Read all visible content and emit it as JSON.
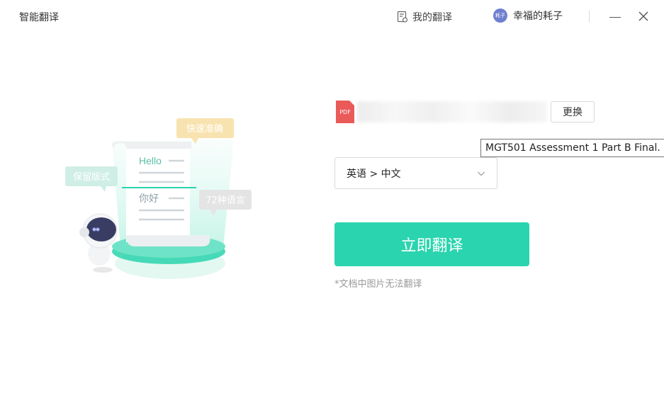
{
  "app": {
    "title": "智能翻译"
  },
  "header": {
    "my_translations": "我的翻译",
    "avatar_text": "耗子",
    "user_name": "幸福的耗子"
  },
  "illustration": {
    "bubble_fast": "快速准确",
    "bubble_keep": "保留版式",
    "bubble_langs": "72种语言",
    "scroll_hello": "Hello",
    "scroll_nihao": "你好"
  },
  "file": {
    "type_label": "PDF",
    "change_button": "更换",
    "tooltip": "MGT501 Assessment 1 Part B Final."
  },
  "language": {
    "selected": "英语 > 中文"
  },
  "actions": {
    "translate_now": "立即翻译"
  },
  "notes": {
    "image_note": "*文档中图片无法翻译"
  },
  "colors": {
    "accent": "#2ad4ae",
    "pdf": "#ea5a59",
    "avatar": "#6f7fd0"
  }
}
